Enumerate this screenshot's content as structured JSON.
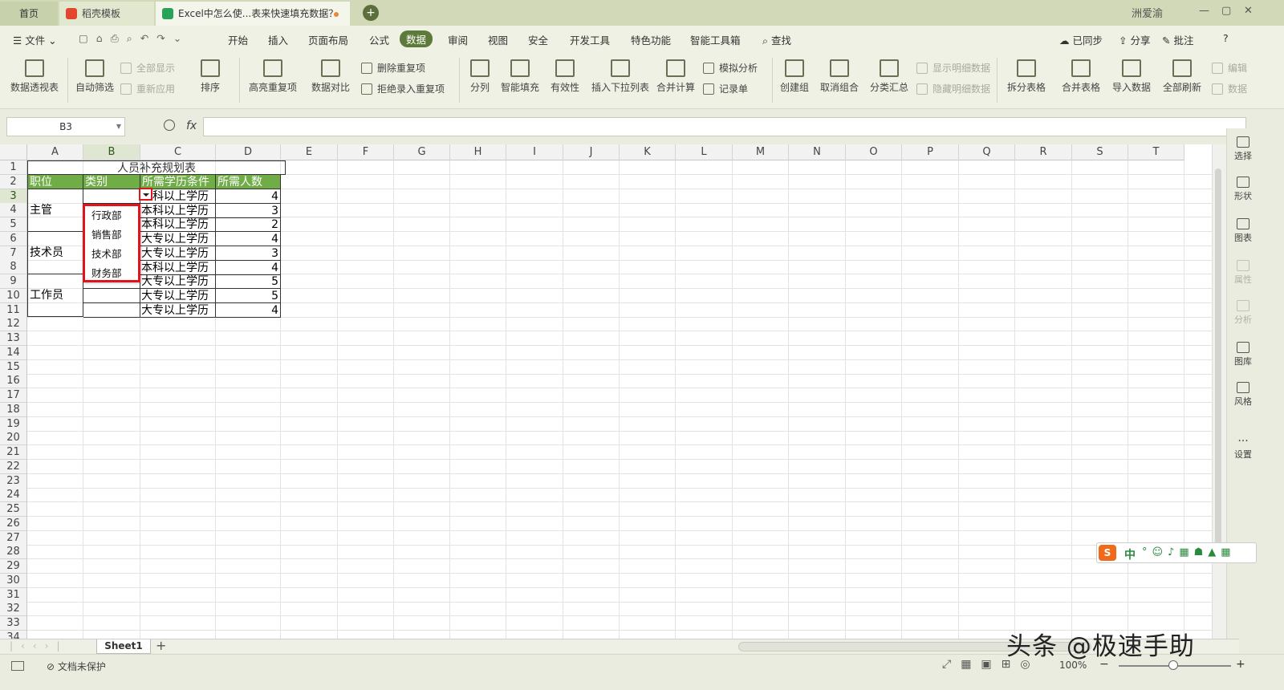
{
  "tabs": {
    "home": "首页",
    "template": "稻壳模板",
    "doc": "Excel中怎么使...表来快速填充数据？"
  },
  "window": {
    "user": "洲爱渝",
    "min": "—",
    "max": "▢",
    "close": "✕"
  },
  "menu": {
    "file": "文件",
    "items": [
      "开始",
      "插入",
      "页面布局",
      "公式",
      "数据",
      "审阅",
      "视图",
      "安全",
      "开发工具",
      "特色功能",
      "智能工具箱"
    ],
    "search": "查找",
    "sync": "已同步",
    "share": "分享",
    "comment": "批注",
    "help": "?"
  },
  "ribbon": {
    "pivot": "数据透视表",
    "autofilter": "自动筛选",
    "showall": "全部显示",
    "reapply": "重新应用",
    "sort": "排序",
    "highlight_dup": "高亮重复项",
    "compare": "数据对比",
    "del_dup": "删除重复项",
    "reject_dup": "拒绝录入重复项",
    "split": "分列",
    "smartfill": "智能填充",
    "validity": "有效性",
    "insert_dd": "插入下拉列表",
    "consolidate": "合并计算",
    "whatif": "模拟分析",
    "record": "记录单",
    "group": "创建组",
    "ungroup": "取消组合",
    "subtotal": "分类汇总",
    "show_detail": "显示明细数据",
    "hide_detail": "隐藏明细数据",
    "split_table": "拆分表格",
    "merge_table": "合并表格",
    "import": "导入数据",
    "refresh": "全部刷新",
    "edit": "编辑",
    "data": "数据"
  },
  "formula_bar": {
    "cell_ref": "B3",
    "fx": "fx",
    "value": ""
  },
  "columns": [
    "A",
    "B",
    "C",
    "D",
    "E",
    "F",
    "G",
    "H",
    "I",
    "J",
    "K",
    "L",
    "M",
    "N",
    "O",
    "P",
    "Q",
    "R",
    "S",
    "T"
  ],
  "rows": [
    "1",
    "2",
    "3",
    "4",
    "5",
    "6",
    "7",
    "8",
    "9",
    "10",
    "11",
    "12",
    "13",
    "14",
    "15",
    "16",
    "17",
    "18",
    "19",
    "20",
    "21",
    "22",
    "23",
    "24",
    "25",
    "26",
    "27",
    "28",
    "29",
    "30",
    "31",
    "32",
    "33",
    "34"
  ],
  "table": {
    "title": "人员补充规划表",
    "headers": [
      "职位",
      "类别",
      "所需学历条件",
      "所需人数"
    ],
    "positions": [
      "主管",
      "技术员",
      "工作员"
    ],
    "education": [
      "本科以上学历",
      "本科以上学历",
      "本科以上学历",
      "大专以上学历",
      "大专以上学历",
      "本科以上学历",
      "大专以上学历",
      "大专以上学历",
      "大专以上学历"
    ],
    "counts": [
      "4",
      "3",
      "2",
      "4",
      "3",
      "4",
      "5",
      "5",
      "4"
    ]
  },
  "dropdown": {
    "options": [
      "行政部",
      "销售部",
      "技术部",
      "财务部"
    ]
  },
  "side_panel": {
    "select": "选择",
    "shape": "形状",
    "chart": "图表",
    "attr": "属性",
    "analyze": "分析",
    "gallery": "图库",
    "style": "风格",
    "settings": "设置"
  },
  "sheet_tab": "Sheet1",
  "status": {
    "protect": "文档未保护",
    "zoom": "100%"
  },
  "ime": {
    "lang": "中"
  },
  "watermark": "头条 @极速手助"
}
